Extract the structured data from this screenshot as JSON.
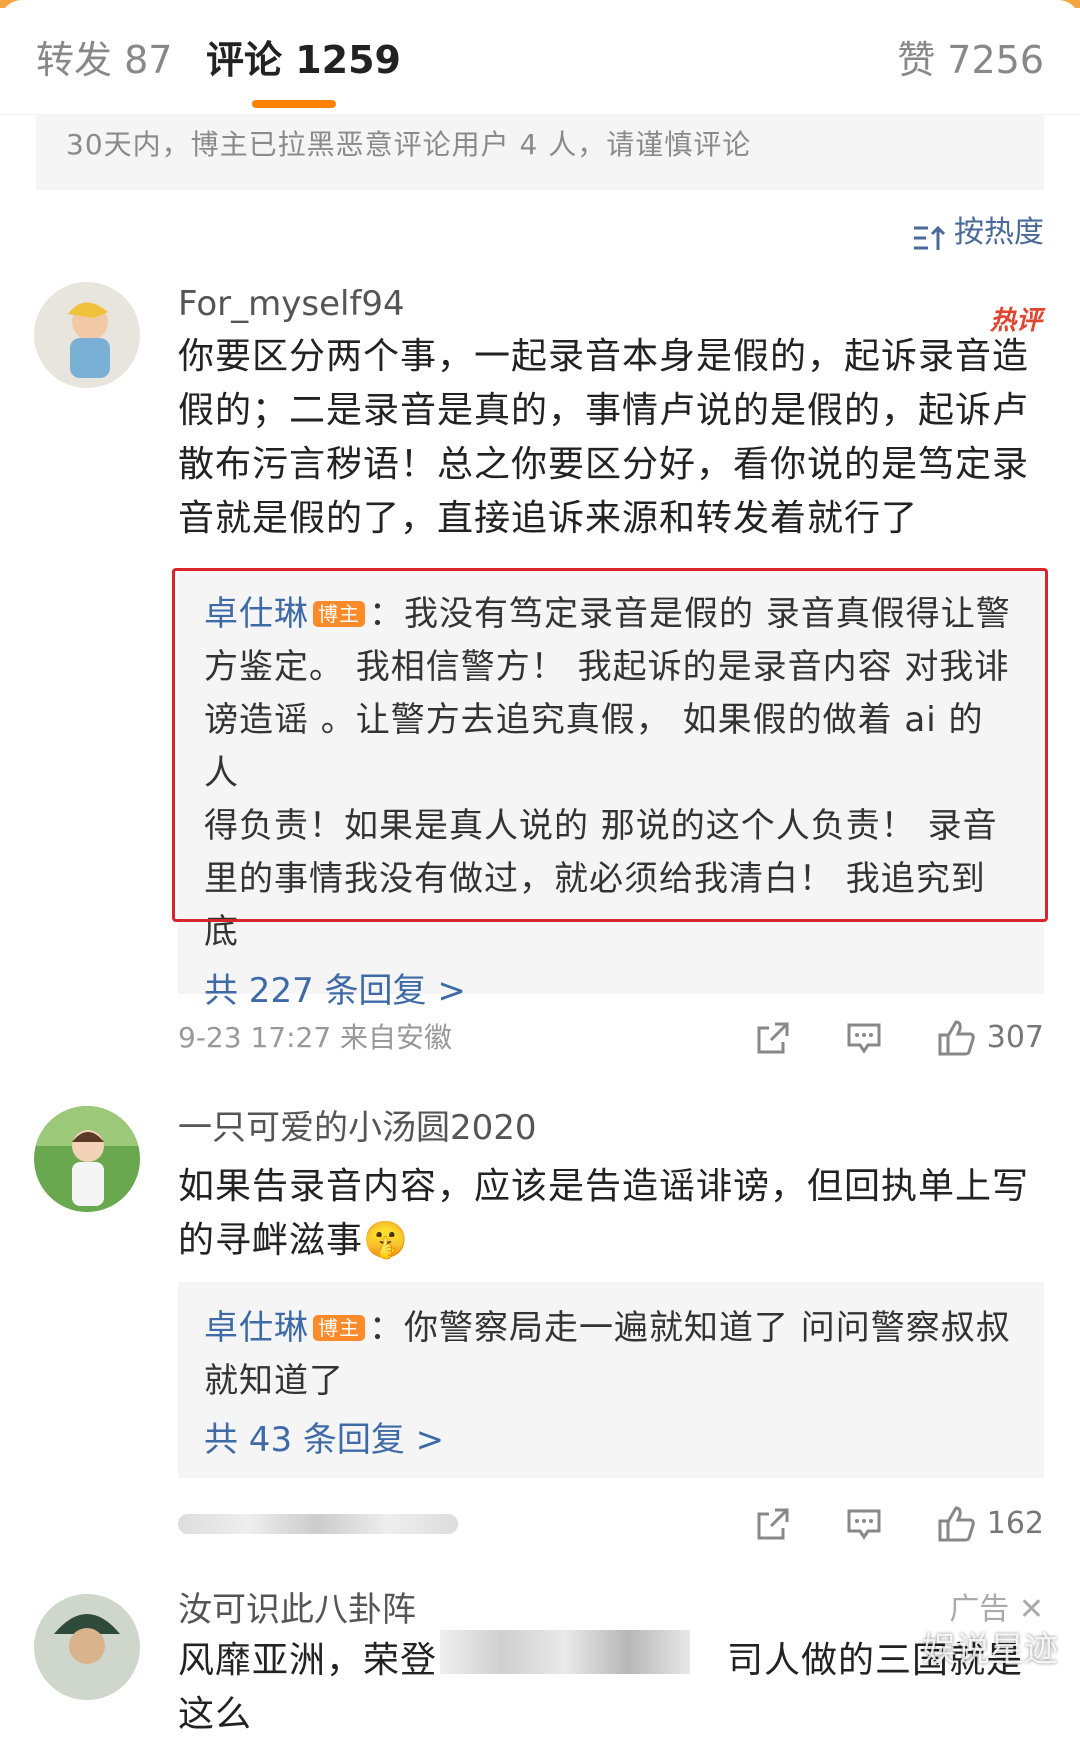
{
  "tabs": {
    "repost": "转发 87",
    "comments": "评论 1259",
    "likes": "赞 7256"
  },
  "notice": "30天内，博主已拉黑恶意评论用户 4 人，请谨慎评论",
  "sort": {
    "label": "按热度",
    "icon": "sort-icon"
  },
  "comments": [
    {
      "username": "For_myself94",
      "hot_badge": "热评",
      "lines": [
        "你要区分两个事，一起录音本身是假的，起诉录音造",
        "假的；二是录音是真的，事情卢说的是假的，起诉卢",
        "散布污言秽语！总之你要区分好，看你说的是笃定录",
        "音就是假的了，直接追诉来源和转发着就行了"
      ],
      "reply": {
        "author": "卓仕琳",
        "badge": "博主",
        "lines": [
          "：我没有笃定录音是假的 录音真假得让警",
          "方鉴定。 我相信警方！ 我起诉的是录音内容 对我诽",
          "谤造谣 。让警方去追究真假， 如果假的做着 ai 的人",
          "得负责！如果是真人说的 那说的这个人负责！ 录音",
          "里的事情我没有做过，就必须给我清白！ 我追究到",
          "底"
        ],
        "count": "共 227 条回复 >"
      },
      "meta": "9-23 17:27  来自安徽",
      "likes": "307"
    },
    {
      "username": "一只可爱的小汤圆2020",
      "lines": [
        "如果告录音内容，应该是告造谣诽谤，但回执单上写",
        "的寻衅滋事"
      ],
      "emoji": "🤫",
      "reply": {
        "author": "卓仕琳",
        "badge": "博主",
        "lines": [
          "：你警察局走一遍就知道了 问问警察叔叔",
          "就知道了"
        ],
        "count": "共 43 条回复 >"
      },
      "likes": "162"
    },
    {
      "username": "汝可识此八卦阵",
      "ad_tag": "广告",
      "line": "风靡亚洲，荣登",
      "line_tail": "司人做的三国就是这么"
    }
  ],
  "watermark": "娱说星迹"
}
